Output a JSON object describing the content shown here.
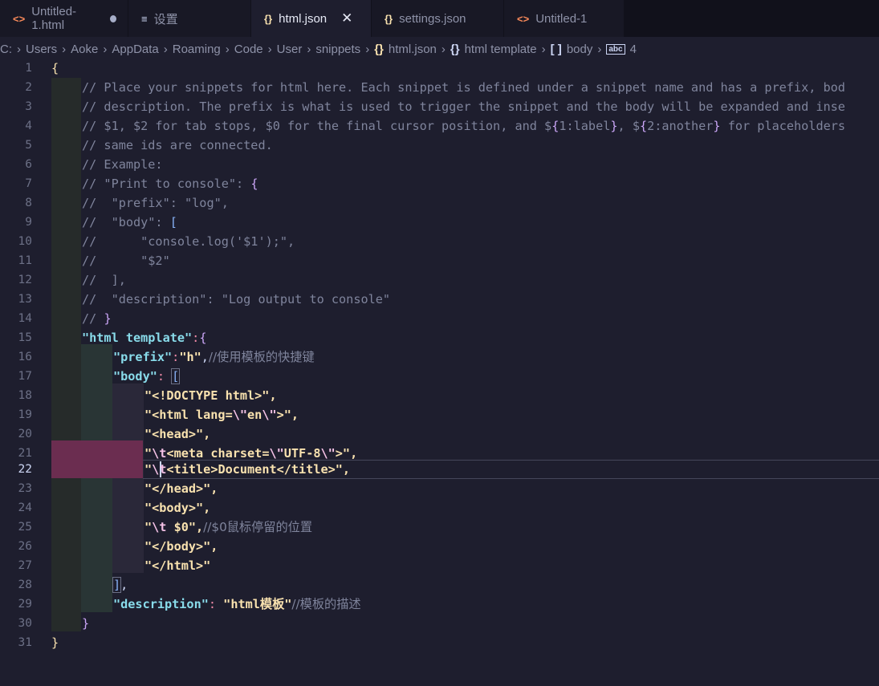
{
  "tabs": [
    {
      "label": "Untitled-1.html",
      "icon": "<>",
      "state": "modified"
    },
    {
      "label": "设置",
      "icon": "≡",
      "state": "normal"
    },
    {
      "label": "html.json",
      "icon": "{}",
      "state": "active"
    },
    {
      "label": "settings.json",
      "icon": "{}",
      "state": "normal"
    },
    {
      "label": "Untitled-1",
      "icon": "<>",
      "state": "normal"
    }
  ],
  "breadcrumb": {
    "c": "C:",
    "users": "Users",
    "aoke": "Aoke",
    "appdata": "AppData",
    "roaming": "Roaming",
    "code": "Code",
    "user": "User",
    "snippets": "snippets",
    "file_icon": "{}",
    "file": "html.json",
    "obj_icon": "{}",
    "obj": "html template",
    "arr_icon": "[ ]",
    "arr": "body",
    "str_icon": "abc",
    "idx": "4"
  },
  "editor": {
    "current_line": 22,
    "line_numbers": [
      "1",
      "2",
      "3",
      "4",
      "5",
      "6",
      "7",
      "8",
      "9",
      "10",
      "11",
      "12",
      "13",
      "14",
      "15",
      "16",
      "17",
      "18",
      "19",
      "20",
      "21",
      "22",
      "23",
      "24",
      "25",
      "26",
      "27",
      "28",
      "29",
      "30",
      "31"
    ],
    "lines": {
      "l1": "{",
      "l2": "// Place your snippets for html here. Each snippet is defined under a snippet name and has a prefix, bod",
      "l3": "// description. The prefix is what is used to trigger the snippet and the body will be expanded and inse",
      "l4a": "// $1, $2 for tab stops, $0 for the final cursor position, and $",
      "l4b": "{",
      "l4c": "1:label",
      "l4d": "}",
      "l4e": ", $",
      "l4f": "{",
      "l4g": "2:another",
      "l4h": "}",
      "l4i": " for placeholders",
      "l5": "// same ids are connected.",
      "l6": "// Example:",
      "l7a": "// \"Print to console\": ",
      "l7b": "{",
      "l8": "//  \"prefix\": \"log\",",
      "l9a": "//  \"body\": ",
      "l9b": "[",
      "l10": "//      \"console.log('$1');\",",
      "l11": "//      \"$2\"",
      "l12": "//  ],",
      "l13": "//  \"description\": \"Log output to console\"",
      "l14a": "// ",
      "l14b": "}",
      "l15a": "\"html template\"",
      "l15b": ":",
      "l15c": "{",
      "l16a": "\"prefix\"",
      "l16b": ":",
      "l16c": "\"h\"",
      "l16d": ",",
      "l16e": "//使用模板的快捷键",
      "l17a": "\"body\"",
      "l17b": ": ",
      "l17c": "[",
      "l18": "\"<!DOCTYPE html>\",",
      "l19a": "\"<html lang=",
      "l19b": "\\\"",
      "l19c": "en",
      "l19d": "\\\"",
      "l19e": ">\",",
      "l20": "\"<head>\",",
      "l21a": "\"",
      "l21b": "\\t",
      "l21c": "<meta charset=",
      "l21d": "\\\"",
      "l21e": "UTF-8",
      "l21f": "\\\"",
      "l21g": ">\",",
      "l22a": "\"",
      "l22b": "\\t",
      "l22c": "<title>Document</title>\",",
      "l23": "\"</head>\",",
      "l24": "\"<body>\",",
      "l25a": "\"",
      "l25b": "\\t",
      "l25c": " $0\",",
      "l25d": "//$0鼠标停留的位置",
      "l26": "\"</body>\",",
      "l27": "\"</html>\"",
      "l28a": "]",
      "l28b": ",",
      "l29a": "\"description\"",
      "l29b": ": ",
      "l29c": "\"html模板\"",
      "l29d": "//模板的描述",
      "l30": "}",
      "l31": "}"
    }
  },
  "colors": {
    "background": "#1e1e2e",
    "tab_bar": "#181825",
    "comment": "#7f849c",
    "key": "#89dceb",
    "string": "#f9e2af",
    "highlight": "#6b2d50"
  }
}
